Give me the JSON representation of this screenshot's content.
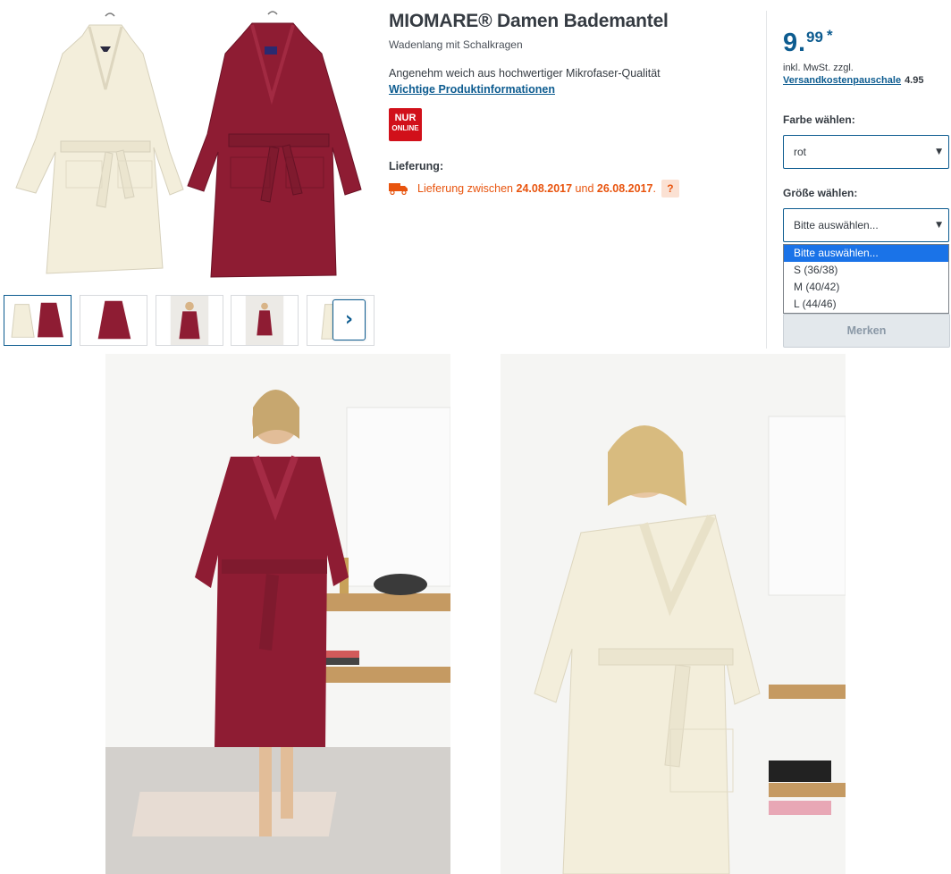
{
  "product": {
    "title": "MIOMARE® Damen Bademantel",
    "subtitle": "Wadenlang mit Schalkragen",
    "description": "Angenehm weich aus hochwertiger Mikrofaser-Qualität",
    "info_link": "Wichtige Produktinformationen",
    "badge": {
      "line1": "NUR",
      "line2": "ONLINE",
      "color": "#d1101a"
    }
  },
  "delivery": {
    "label": "Lieferung:",
    "prefix": "Lieferung zwischen",
    "date_from": "24.08.2017",
    "connector": "und",
    "date_to": "26.08.2017",
    "suffix": ".",
    "help": "?",
    "icon": "truck-icon",
    "color": "#e8540e"
  },
  "price": {
    "integer": "9",
    "separator": ".",
    "decimals": "99",
    "asterisk": "*",
    "tax_note": "inkl. MwSt. zzgl.",
    "shipping_link": "Versandkostenpauschale",
    "shipping_value": "4.95",
    "color": "#0d5c90"
  },
  "color_select": {
    "label": "Farbe wählen:",
    "value": "rot"
  },
  "size_select": {
    "label": "Größe wählen:",
    "value": "Bitte auswählen...",
    "options": [
      "Bitte auswählen...",
      "S (36/38)",
      "M (40/42)",
      "L (44/46)"
    ],
    "selected_index": 0
  },
  "merken_button": "Merken",
  "gallery": {
    "thumbnail_count": 5,
    "active_index": 0,
    "next_icon": "›",
    "next_icon_name": "chevron-right-icon"
  },
  "colors": {
    "red_robe": "#8e1c33",
    "cream_robe": "#f3eedb",
    "accent": "#0d5c90"
  }
}
